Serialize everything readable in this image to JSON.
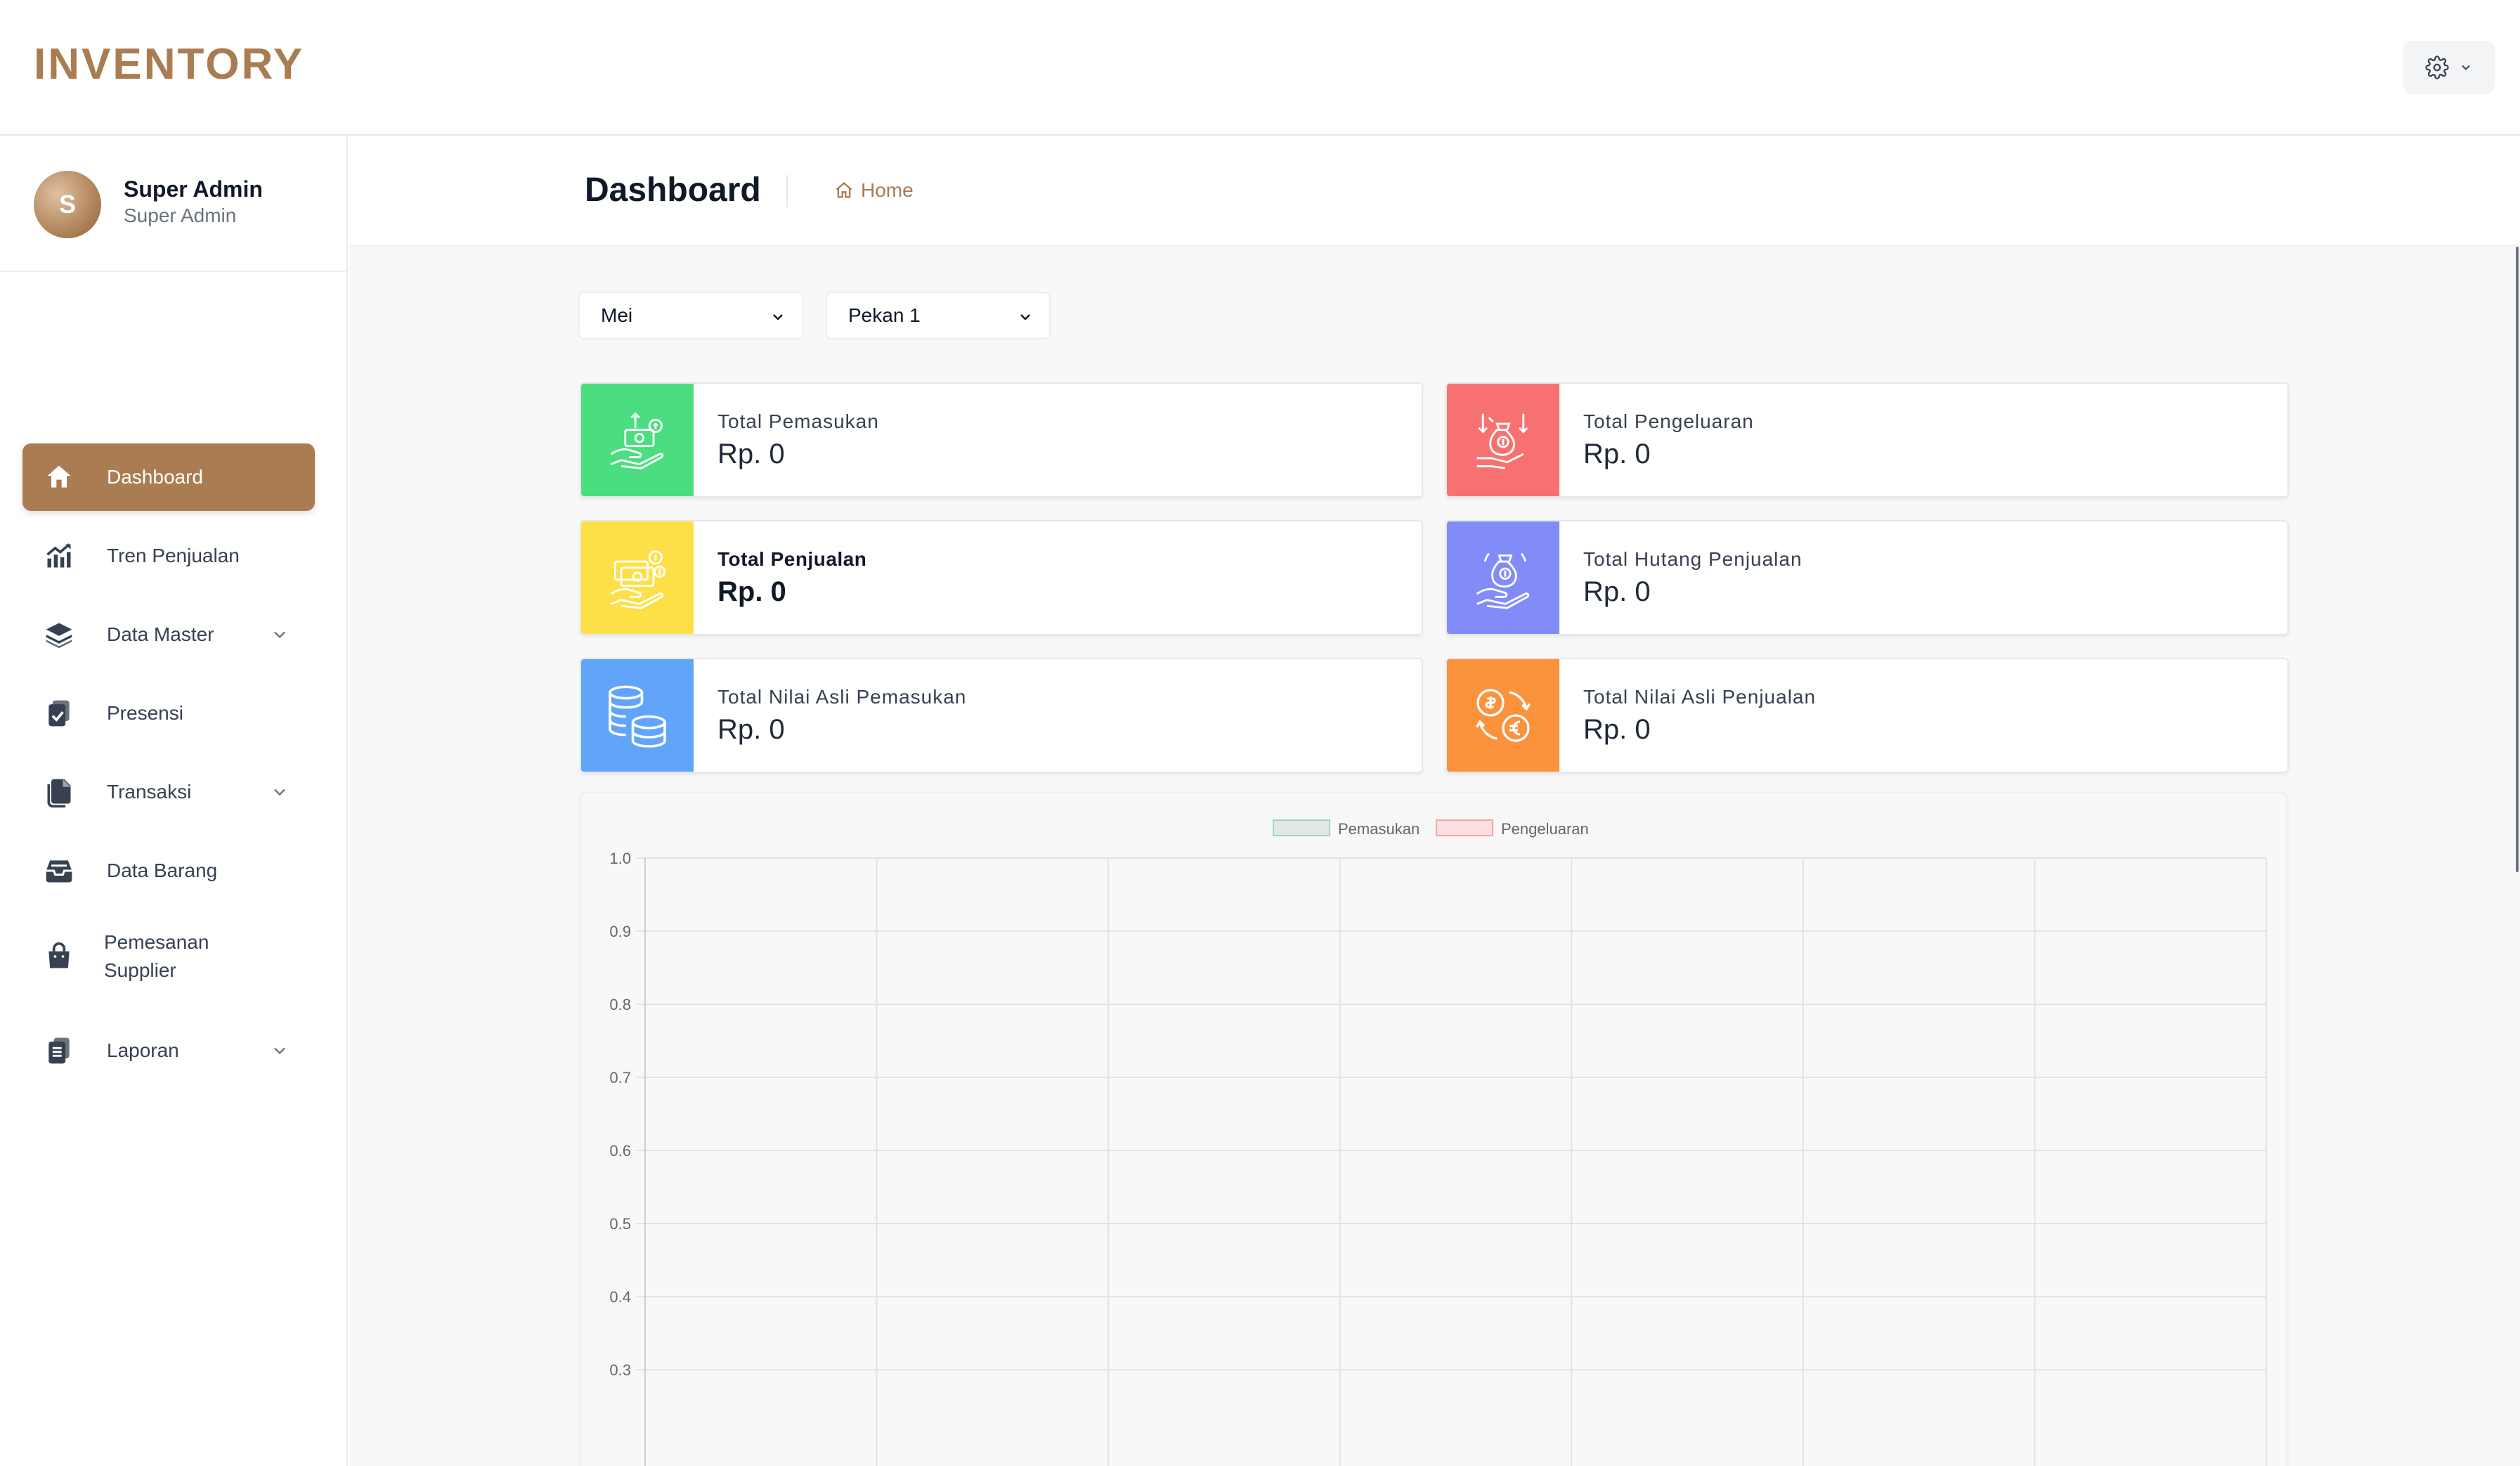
{
  "app": {
    "brand": "INVENTORY"
  },
  "header": {
    "settings_icon": "gear-icon"
  },
  "profile": {
    "initial": "S",
    "name": "Super Admin",
    "role": "Super Admin"
  },
  "sidebar": {
    "items": [
      {
        "label": "Dashboard",
        "icon": "home-icon",
        "active": true,
        "has_children": false
      },
      {
        "label": "Tren Penjualan",
        "icon": "trend-chart-icon",
        "active": false,
        "has_children": false
      },
      {
        "label": "Data Master",
        "icon": "layers-icon",
        "active": false,
        "has_children": true
      },
      {
        "label": "Presensi",
        "icon": "clipboard-check-icon",
        "active": false,
        "has_children": false
      },
      {
        "label": "Transaksi",
        "icon": "documents-icon",
        "active": false,
        "has_children": true
      },
      {
        "label": "Data Barang",
        "icon": "inbox-icon",
        "active": false,
        "has_children": false
      },
      {
        "label": "Pemesanan Supplier",
        "label_line1": "Pemesanan",
        "label_line2": "Supplier",
        "icon": "shopping-bag-icon",
        "active": false,
        "has_children": false
      },
      {
        "label": "Laporan",
        "icon": "report-icon",
        "active": false,
        "has_children": true
      }
    ]
  },
  "page": {
    "title": "Dashboard",
    "breadcrumb": "Home"
  },
  "filters": {
    "month": {
      "value": "Mei",
      "options": [
        "Mei"
      ]
    },
    "week": {
      "value": "Pekan 1",
      "options": [
        "Pekan 1"
      ]
    }
  },
  "cards": [
    {
      "label": "Total Pemasukan",
      "value": "Rp. 0",
      "color": "#4ade80",
      "icon": "money-hand-up-icon"
    },
    {
      "label": "Total Pengeluaran",
      "value": "Rp. 0",
      "color": "#f87171",
      "icon": "money-bag-down-icon"
    },
    {
      "label": "Total Penjualan",
      "value": "Rp. 0",
      "color": "#fde047",
      "icon": "cash-hand-icon"
    },
    {
      "label": "Total Hutang Penjualan",
      "value": "Rp. 0",
      "color": "#818cf8",
      "icon": "money-bag-hand-icon"
    },
    {
      "label": "Total Nilai Asli Pemasukan",
      "value": "Rp. 0",
      "color": "#60a5fa",
      "icon": "coin-stack-icon"
    },
    {
      "label": "Total Nilai Asli Penjualan",
      "value": "Rp. 0",
      "color": "#fb923c",
      "icon": "currency-exchange-icon"
    }
  ],
  "chart_data": {
    "type": "bar",
    "legend_position": "top-center",
    "grid": true,
    "series": [
      {
        "name": "Pemasukan",
        "color": "#99d5d5",
        "fill": "#e3e7e5",
        "values": []
      },
      {
        "name": "Pengeluaran",
        "color": "#f4a3a9",
        "fill": "#fde0e2",
        "values": []
      }
    ],
    "y_ticks": [
      "1.0",
      "0.9",
      "0.8",
      "0.7",
      "0.6",
      "0.5",
      "0.4",
      "0.3"
    ],
    "ylim_visible": [
      0.3,
      1.0
    ],
    "x_gridlines": 7
  }
}
